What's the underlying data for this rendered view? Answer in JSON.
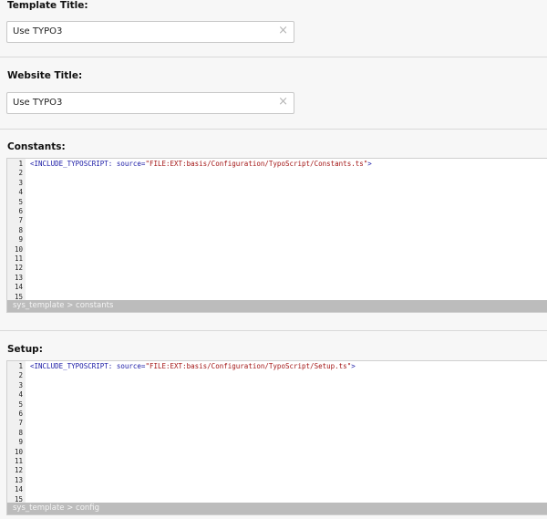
{
  "template_title": {
    "label": "Template Title:",
    "value": "Use TYPO3",
    "clear_icon": "×"
  },
  "website_title": {
    "label": "Website Title:",
    "value": "Use TYPO3",
    "clear_icon": "×"
  },
  "constants": {
    "label": "Constants:",
    "line_numbers": [
      "1",
      "2",
      "3",
      "4",
      "5",
      "6",
      "7",
      "8",
      "9",
      "10",
      "11",
      "12",
      "13",
      "14",
      "15"
    ],
    "code": {
      "directive": "<INCLUDE_TYPOSCRIPT:",
      "attr": " source=",
      "value": "\"FILE:EXT:basis/Configuration/TypoScript/Constants.ts\"",
      "close": ">"
    },
    "status": "sys_template > constants"
  },
  "setup": {
    "label": "Setup:",
    "line_numbers": [
      "1",
      "2",
      "3",
      "4",
      "5",
      "6",
      "7",
      "8",
      "9",
      "10",
      "11",
      "12",
      "13",
      "14",
      "15"
    ],
    "code": {
      "directive": "<INCLUDE_TYPOSCRIPT:",
      "attr": " source=",
      "value": "\"FILE:EXT:basis/Configuration/TypoScript/Setup.ts\"",
      "close": ">"
    },
    "status": "sys_template > config"
  },
  "colors": {
    "keyword": "#1a1aa6",
    "string": "#a31515",
    "status_bar": "#bcbcbc"
  }
}
